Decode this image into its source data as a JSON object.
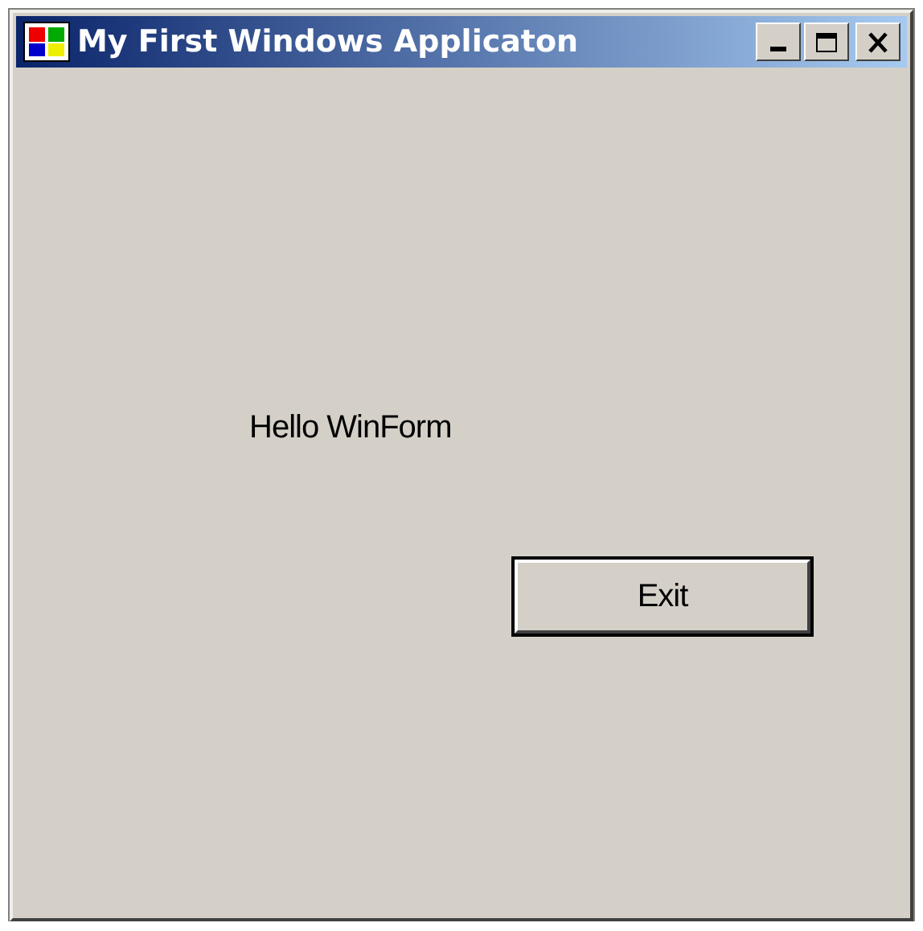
{
  "window": {
    "title": "My First Windows Applicaton"
  },
  "label": {
    "text": "Hello WinForm"
  },
  "button": {
    "label": "Exit",
    "default": true
  }
}
